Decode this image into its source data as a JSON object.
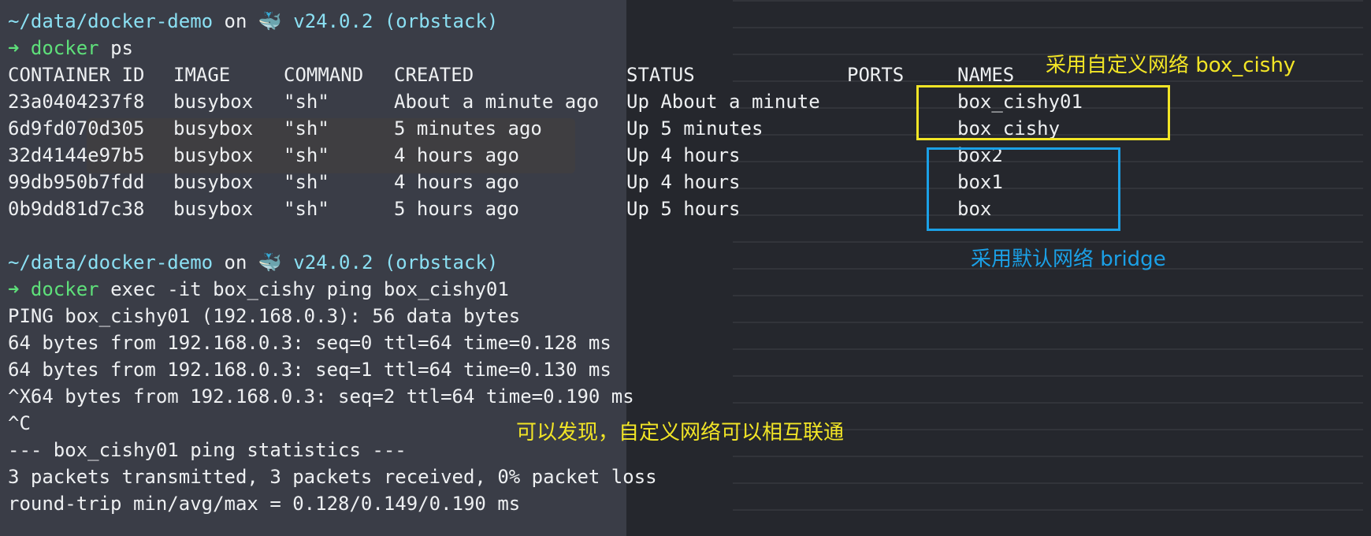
{
  "prompt1": {
    "path": "~/data/docker-demo",
    "on": "on",
    "whale": "🐳",
    "version": "v24.0.2 (orbstack)",
    "arrow": "➜",
    "cmd": "docker",
    "args": "ps"
  },
  "table": {
    "headers": [
      "CONTAINER ID",
      "IMAGE",
      "COMMAND",
      "CREATED",
      "STATUS",
      "PORTS",
      "NAMES"
    ],
    "rows": [
      [
        "23a0404237f8",
        "busybox",
        "\"sh\"",
        "About a minute ago",
        "Up About a minute",
        "",
        "box_cishy01"
      ],
      [
        "6d9fd070d305",
        "busybox",
        "\"sh\"",
        "5 minutes ago",
        "Up 5 minutes",
        "",
        "box_cishy"
      ],
      [
        "32d4144e97b5",
        "busybox",
        "\"sh\"",
        "4 hours ago",
        "Up 4 hours",
        "",
        "box2"
      ],
      [
        "99db950b7fdd",
        "busybox",
        "\"sh\"",
        "4 hours ago",
        "Up 4 hours",
        "",
        "box1"
      ],
      [
        "0b9dd81d7c38",
        "busybox",
        "\"sh\"",
        "5 hours ago",
        "Up 5 hours",
        "",
        "box"
      ]
    ]
  },
  "prompt2": {
    "path": "~/data/docker-demo",
    "on": "on",
    "whale": "🐳",
    "version": "v24.0.2 (orbstack)",
    "arrow": "➜",
    "cmd": "docker",
    "args": "exec -it box_cishy ping box_cishy01"
  },
  "output": [
    "PING box_cishy01 (192.168.0.3): 56 data bytes",
    "64 bytes from 192.168.0.3: seq=0 ttl=64 time=0.128 ms",
    "64 bytes from 192.168.0.3: seq=1 ttl=64 time=0.130 ms",
    "^X64 bytes from 192.168.0.3: seq=2 ttl=64 time=0.190 ms",
    "^C",
    "--- box_cishy01 ping statistics ---",
    "3 packets transmitted, 3 packets received, 0% packet loss",
    "round-trip min/avg/max = 0.128/0.149/0.190 ms"
  ],
  "annotations": {
    "custom_network": "采用自定义网络 box_cishy",
    "default_network": "采用默认网络 bridge",
    "finding": "可以发现，自定义网络可以相互联通"
  },
  "colors": {
    "highlight_yellow": "#f2e526",
    "highlight_blue": "#1ba0e6",
    "path_cyan": "#8be0f3",
    "prompt_green": "#5ee07a"
  }
}
